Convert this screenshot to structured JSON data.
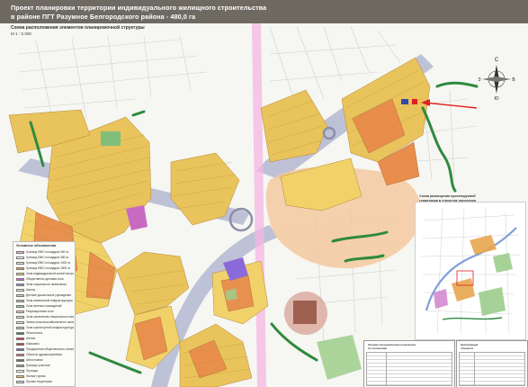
{
  "header": {
    "title_line1": "Проект планировки территории индивидуального жилищного строительства",
    "title_line2": "в районе ПГТ Разумное Белгородского района - 480,0 га"
  },
  "map": {
    "scheme_caption": "Схема расположения элементов планировочной структуры",
    "scale": "М 1 : 5 000"
  },
  "compass": {
    "n": "С",
    "s": "Ю",
    "w": "З",
    "e": "В"
  },
  "legend": {
    "title": "Условные обозначения",
    "items": [
      {
        "label": "Граница ИЖС площадью 400 га",
        "color": "#f3b8e6"
      },
      {
        "label": "Граница ИЖС площадью 480 га",
        "color": "#ffffff"
      },
      {
        "label": "Граница ИЖС площадью 1000 га",
        "color": "#f2e6c8"
      },
      {
        "label": "Граница ИЖС площадью 1500 га",
        "color": "#e8a64f"
      },
      {
        "label": "Зона индивидуальной жилой застройки",
        "color": "#ecd460"
      },
      {
        "label": "Общественно-деловая зона",
        "color": "#c86ac2"
      },
      {
        "label": "Зона социального назначения",
        "color": "#a88ad8"
      },
      {
        "label": "Школы",
        "color": "#e4e4e4"
      },
      {
        "label": "Детские дошкольные учреждения",
        "color": "#b8e0b0"
      },
      {
        "label": "Зона инженерной инфраструктуры",
        "color": "#d9b1ad"
      },
      {
        "label": "Зона зеленых насаждений",
        "color": "#9dce8c"
      },
      {
        "label": "Рекреационная зона",
        "color": "#f7d0b0"
      },
      {
        "label": "Зона озеленения специального назначения",
        "color": "#cfe7c3"
      },
      {
        "label": "Земли сельскохозяйственного назначения",
        "color": "#f3ead8"
      },
      {
        "label": "Зона транспортной инфраструктуры",
        "color": "#c9c9d6"
      },
      {
        "label": "Лесополосы",
        "color": "#3a8f46"
      },
      {
        "label": "Аптека",
        "color": "#e23b3b"
      },
      {
        "label": "Магазины",
        "color": "#c23a3a"
      },
      {
        "label": "Предприятия общественного питания",
        "color": "#7a62c2"
      },
      {
        "label": "Объекты здравоохранения",
        "color": "#d26a9a"
      },
      {
        "label": "Автостоянки",
        "color": "#6a6a6a"
      },
      {
        "label": "Границы участков",
        "color": "#9a9a9a"
      },
      {
        "label": "Проезды",
        "color": "#ffffff"
      },
      {
        "label": "Жилые группы",
        "color": "#e7c25a"
      },
      {
        "label": "Прочие территории",
        "color": "#dadada"
      }
    ]
  },
  "inset": {
    "caption_line1": "Схема размещения проектируемой",
    "caption_line2": "территории в структуре поселения"
  },
  "stat_table": {
    "title_line1": "Технико-экономические показатели",
    "title_line2": "по поселению"
  },
  "expl_table": {
    "title_line1": "Экспликация",
    "title_line2": "объектов"
  },
  "colors": {
    "header": "#6e6a62",
    "plot_fill": "#e9c35c",
    "plot_fill_alt": "#f1d26a",
    "public_orange": "#e88d4c",
    "boulevard": "#b8bcd4",
    "railway_corridor": "#f4b6e3",
    "recreation": "#f4c9a0",
    "greenbelt": "#2f8a3e",
    "annotation_red": "#e02020"
  }
}
